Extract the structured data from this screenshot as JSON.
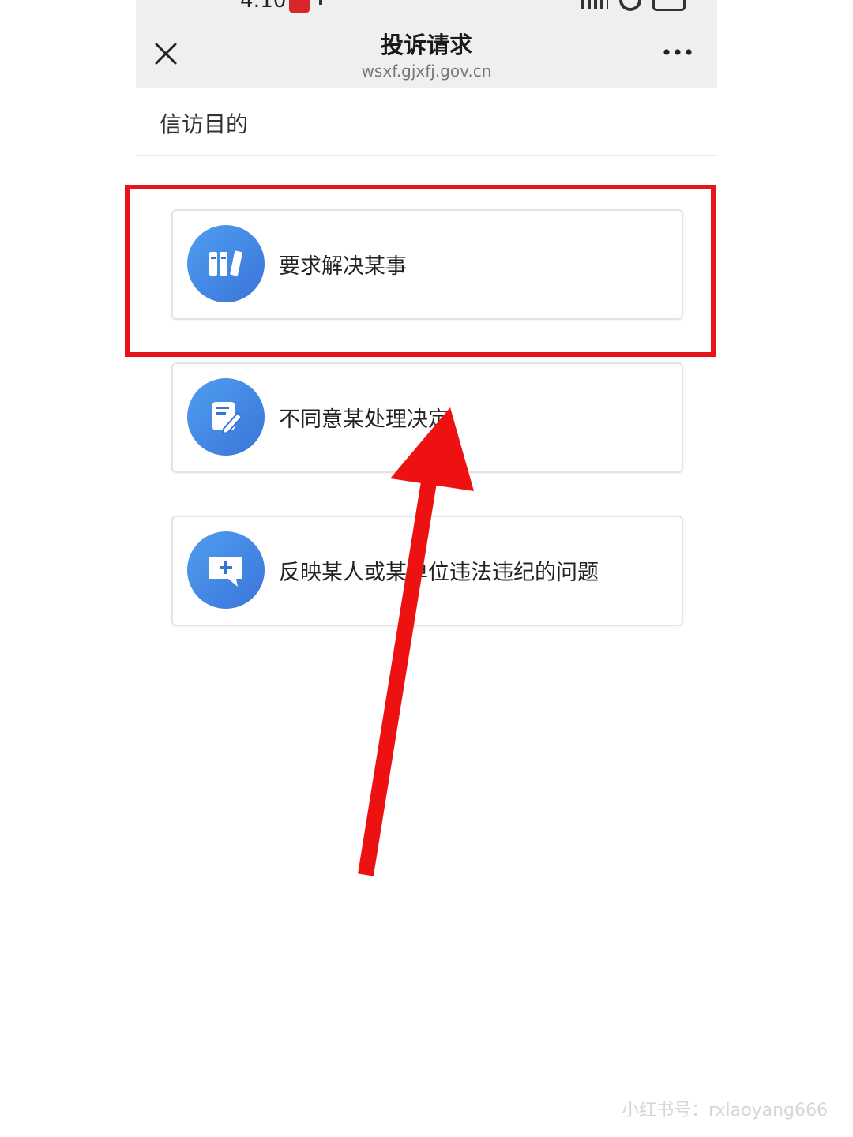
{
  "status_bar": {
    "time": "4:10"
  },
  "title_bar": {
    "title": "投诉请求",
    "url": "wsxf.gjxfj.gov.cn"
  },
  "section": {
    "title": "信访目的"
  },
  "options": [
    {
      "label": "要求解决某事",
      "icon": "books-icon"
    },
    {
      "label": "不同意某处理决定",
      "icon": "edit-document-icon"
    },
    {
      "label": "反映某人或某单位违法违纪的问题",
      "icon": "add-comment-icon"
    }
  ],
  "annotations": {
    "highlight_color": "#e8141b",
    "arrow_color": "#ee1111"
  },
  "watermark": "小红书号：rxlaoyang666",
  "colors": {
    "header_bg": "#efefef",
    "icon_gradient_start": "#4f9ef0",
    "icon_gradient_end": "#3b74d9"
  }
}
